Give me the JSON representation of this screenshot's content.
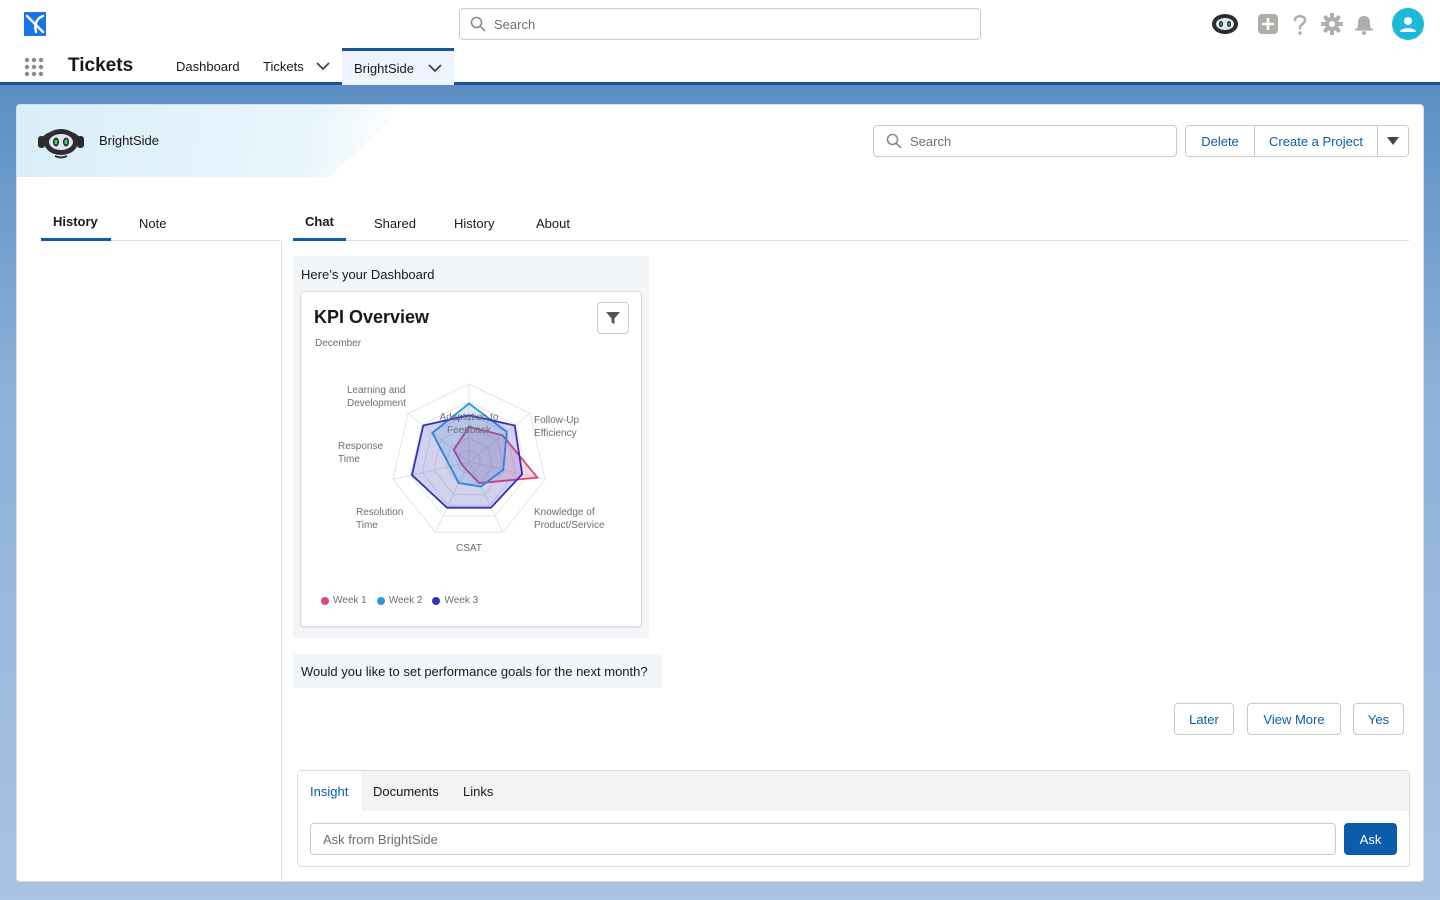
{
  "global": {
    "search_placeholder": "Search"
  },
  "app": {
    "name": "Tickets",
    "nav": [
      {
        "label": "Dashboard"
      },
      {
        "label": "Tickets"
      },
      {
        "label": "BrightSide"
      }
    ]
  },
  "record": {
    "name": "BrightSide",
    "search_placeholder": "Search",
    "buttons": {
      "delete": "Delete",
      "create": "Create a Project"
    }
  },
  "left_tabs": [
    {
      "label": "History",
      "active": true
    },
    {
      "label": "Note",
      "active": false
    }
  ],
  "right_tabs": [
    {
      "label": "Chat",
      "active": true
    },
    {
      "label": "Shared",
      "active": false
    },
    {
      "label": "History",
      "active": false
    },
    {
      "label": "About",
      "active": false
    }
  ],
  "chat": {
    "intro": "Here’s your Dashboard",
    "question": "Would you like to set performance goals for the next month?",
    "actions": {
      "later": "Later",
      "view_more": "View More",
      "yes": "Yes"
    }
  },
  "kpi": {
    "title": "KPI Overview",
    "subtitle": "December"
  },
  "chart_data": {
    "type": "radar",
    "title": "KPI Overview",
    "subtitle": "December",
    "axes": [
      [
        "Adaptation to",
        "Feedback"
      ],
      [
        "Follow-Up",
        "Efficiency"
      ],
      [
        "Knowledge of",
        "Product/Service"
      ],
      [
        "CSAT"
      ],
      [
        "Resolution",
        "Time"
      ],
      [
        "Response",
        "Time"
      ],
      [
        "Learning and",
        "Development"
      ]
    ],
    "range": [
      0,
      1
    ],
    "series": [
      {
        "name": "Week 1",
        "color": "#e0457b",
        "values": [
          0.45,
          0.55,
          0.9,
          0.3,
          0.1,
          0.1,
          0.25
        ]
      },
      {
        "name": "Week 2",
        "color": "#2a9ae0",
        "values": [
          0.75,
          0.62,
          0.45,
          0.35,
          0.3,
          0.25,
          0.6
        ]
      },
      {
        "name": "Week 3",
        "color": "#3232b8",
        "values": [
          0.6,
          0.75,
          0.7,
          0.65,
          0.65,
          0.75,
          0.75
        ]
      }
    ],
    "legend": "bottom-left"
  },
  "composer": {
    "tabs": [
      {
        "label": "Insight",
        "active": true
      },
      {
        "label": "Documents",
        "active": false
      },
      {
        "label": "Links",
        "active": false
      }
    ],
    "placeholder": "Ask from BrightSide",
    "ask": "Ask"
  },
  "colors": {
    "brand": "#0b5cab",
    "nav_underline": "#1b5297",
    "avatar": "#1ab9d8"
  }
}
